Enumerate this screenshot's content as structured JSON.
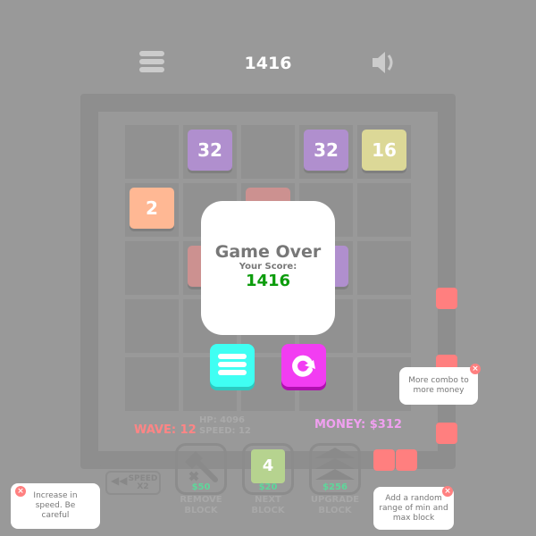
{
  "header": {
    "score": "1416",
    "menu_icon": "menu-icon",
    "sound_icon": "speaker-icon"
  },
  "board": {
    "tiles": [
      {
        "row": 0,
        "col": 1,
        "value": "32",
        "color": "#b08fce"
      },
      {
        "row": 0,
        "col": 3,
        "value": "32",
        "color": "#b08fce"
      },
      {
        "row": 0,
        "col": 4,
        "value": "16",
        "color": "#dcd897"
      },
      {
        "row": 1,
        "col": 0,
        "value": "2",
        "color": "#ffb894"
      },
      {
        "row": 1,
        "col": 2,
        "value": "",
        "color": "#cc9190"
      },
      {
        "row": 2,
        "col": 1,
        "value": "",
        "color": "#cc9190"
      },
      {
        "row": 2,
        "col": 3,
        "value": "",
        "color": "#b08fce"
      }
    ]
  },
  "dialog": {
    "title": "Game Over",
    "subtitle": "Your Score:",
    "score": "1416",
    "score_color": "#0c9c0c"
  },
  "buttons": {
    "menu_color": "#3ffff3",
    "restart_color": "#f23df2"
  },
  "stats": {
    "wave": "WAVE: 12",
    "hp": "HP: 4096",
    "speed": "SPEED: 12",
    "money": "MONEY: $312"
  },
  "shop": [
    {
      "price": "$50",
      "label1": "REMOVE",
      "label2": "BLOCK"
    },
    {
      "price": "$20",
      "label1": "NEXT",
      "label2": "BLOCK",
      "next_value": "4"
    },
    {
      "price": "$256",
      "label1": "UPGRADE",
      "label2": "BLOCK"
    }
  ],
  "speed_button": {
    "line1": "SPEED",
    "line2": "X2"
  },
  "tips": {
    "combo": "More combo to more money",
    "speed": "Increase in speed. Be careful",
    "range": "Add a random range of min and max block"
  }
}
